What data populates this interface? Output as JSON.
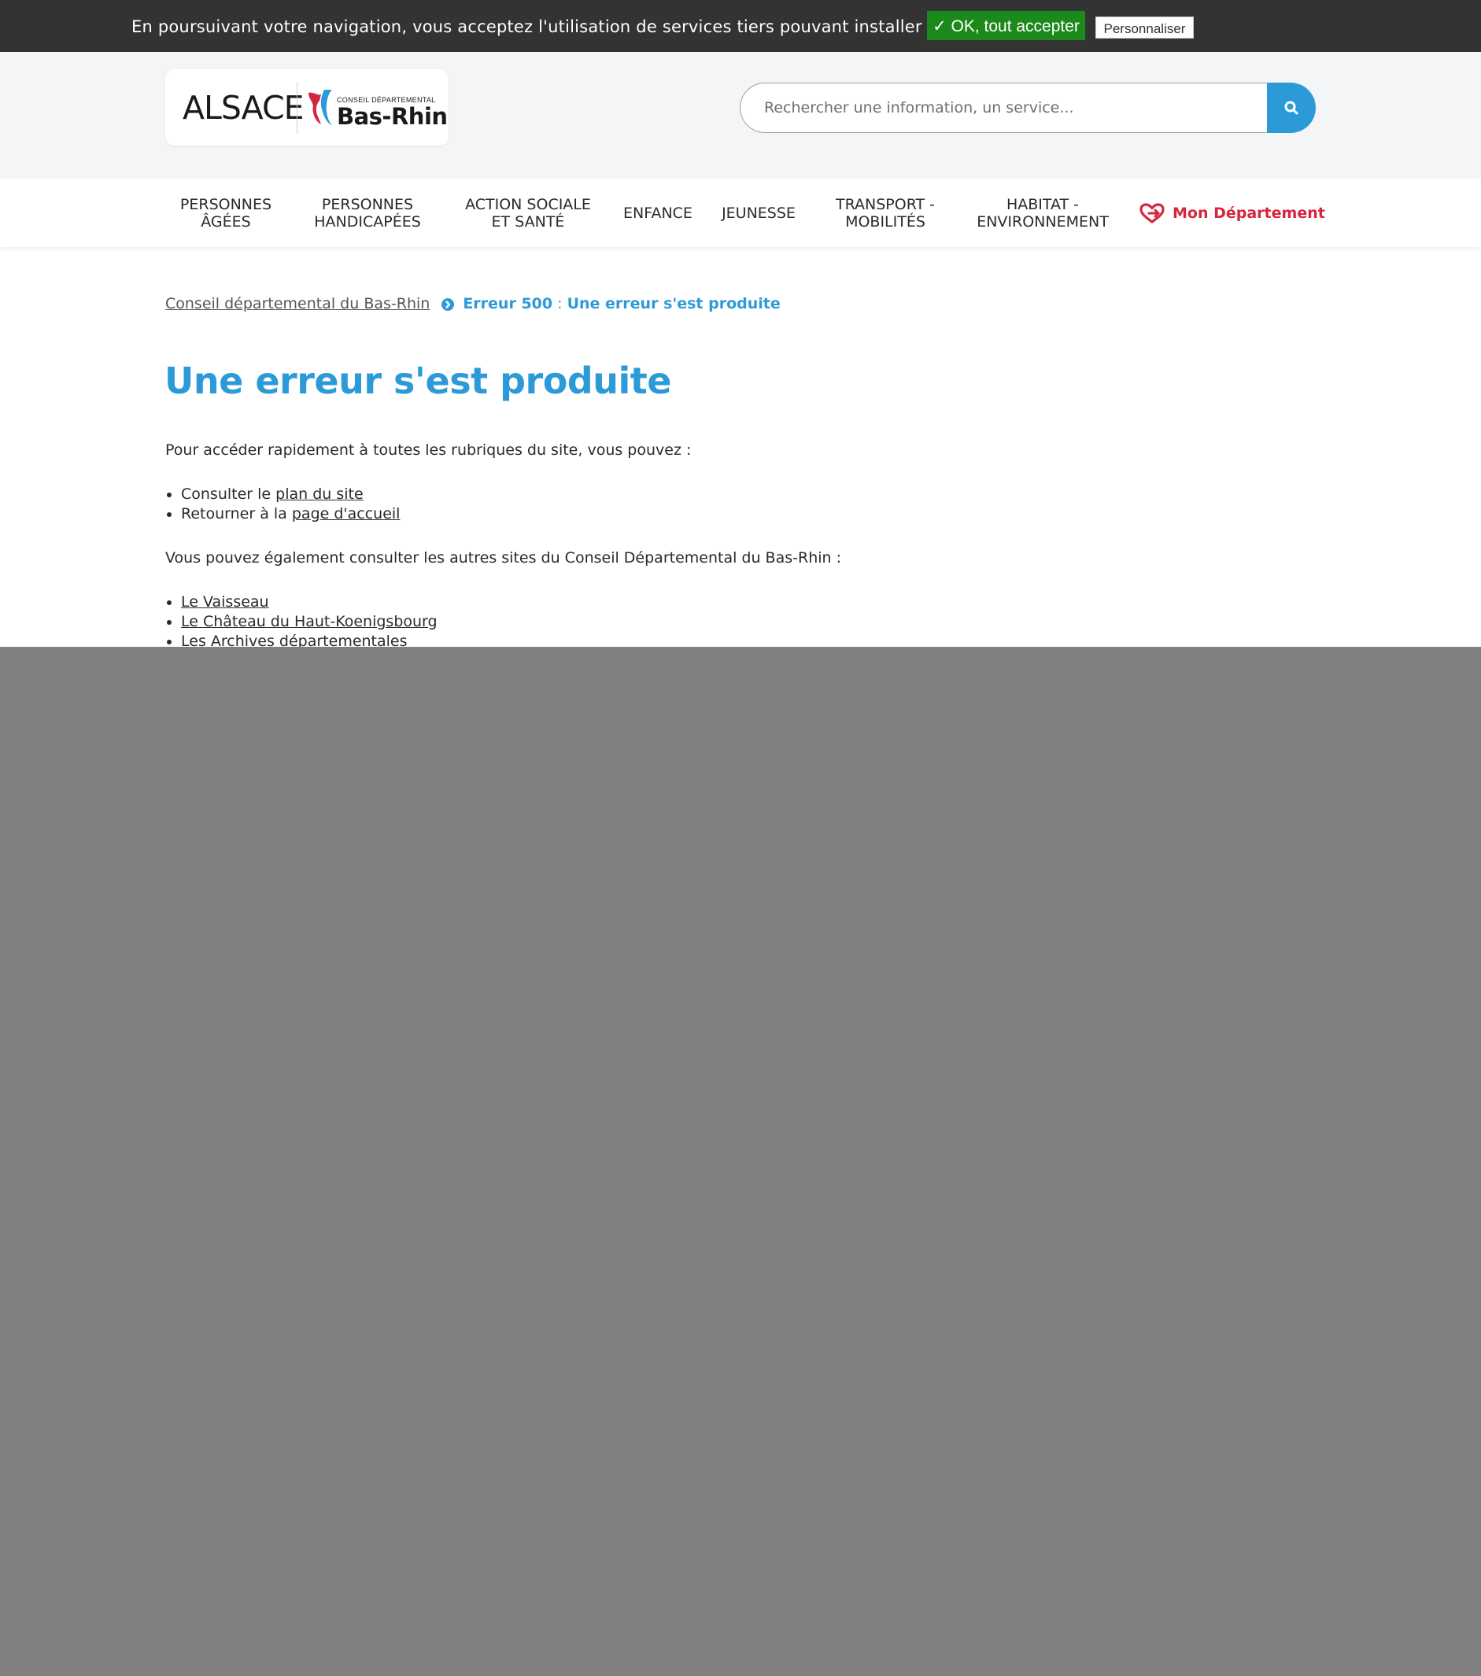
{
  "cookie_banner": {
    "message": "En poursuivant votre navigation, vous acceptez l'utilisation de services tiers pouvant installer des cookies",
    "accept_label": "✓ OK, tout accepter",
    "customize_label": "Personnaliser"
  },
  "header": {
    "logo_alsace": "ALSACE",
    "logo_small": "CONSEIL DÉPARTEMENTAL",
    "logo_big": "Bas-Rhin",
    "search_placeholder": "Rechercher une information, un service..."
  },
  "nav": {
    "items": [
      {
        "line1": "PERSONNES",
        "line2": "ÂGÉES"
      },
      {
        "line1": "PERSONNES",
        "line2": "HANDICAPÉES"
      },
      {
        "line1": "ACTION SOCIALE",
        "line2": "ET SANTÉ"
      },
      {
        "line1": "ENFANCE",
        "line2": ""
      },
      {
        "line1": "JEUNESSE",
        "line2": ""
      },
      {
        "line1": "TRANSPORT -",
        "line2": "MOBILITÉS"
      },
      {
        "line1": "HABITAT -",
        "line2": "ENVIRONNEMENT"
      }
    ],
    "mon_departement": "Mon Département"
  },
  "breadcrumb": {
    "home": "Conseil départemental du Bas-Rhin",
    "current_code": "Erreur 500",
    "current_sep": " : ",
    "current_title": "Une erreur s'est produite"
  },
  "main": {
    "title": "Une erreur s'est produite",
    "intro": "Pour accéder rapidement à toutes les rubriques du site, vous pouvez :",
    "quick_links": [
      {
        "prefix": "Consulter le ",
        "link": "plan du site"
      },
      {
        "prefix": "Retourner à la ",
        "link": "page d'accueil"
      }
    ],
    "other_sites_intro": "Vous pouvez également consulter les autres sites du Conseil Départemental du Bas-Rhin :",
    "other_sites": [
      "Le Vaisseau",
      "Le Château du Haut-Koenigsbourg",
      "Les Archives départementales"
    ]
  },
  "colors": {
    "accent": "#2d9ad8",
    "brand_red": "#d6263f",
    "cookie_bar": "#333333",
    "accept_green": "#1b8a1b",
    "overlay": "#808080"
  }
}
